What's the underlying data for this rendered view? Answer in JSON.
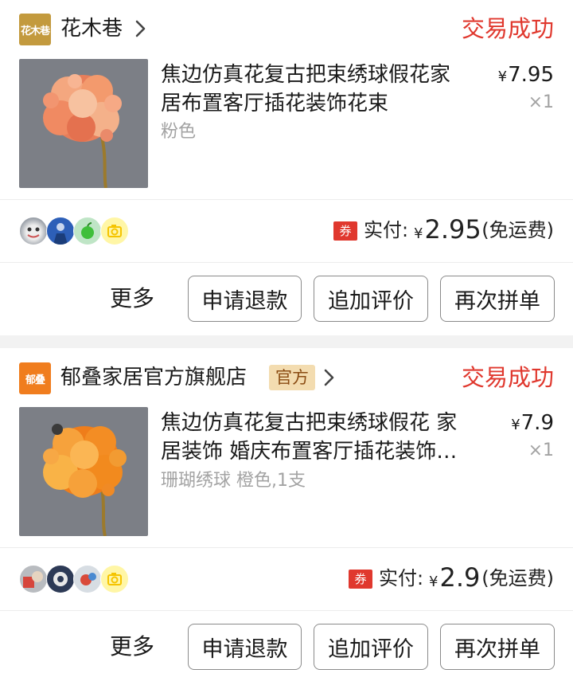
{
  "orders": [
    {
      "shop": {
        "logo_text": "花木巷",
        "logo_color": "#c39a3e",
        "name": "花木巷",
        "official_tag": ""
      },
      "status": "交易成功",
      "product": {
        "title_line1": "焦边仿真花复古把束绣球假花家",
        "title_line2": "居布置客厅插花装饰花束",
        "sku": "粉色",
        "price_symbol": "¥",
        "price": "7.95",
        "quantity": "×1",
        "image_colors": {
          "background": "#7c7f86",
          "bloom": "#f0946a",
          "stem": "#9c7a2c"
        }
      },
      "payment": {
        "coupon_badge": "券",
        "paid_label": "实付:",
        "paid_symbol": "¥",
        "paid_amount": "2.95",
        "shipping_note": "(免运费)"
      },
      "actions": {
        "more": "更多",
        "refund": "申请退款",
        "add_review": "追加评价",
        "rebuy": "再次拼单"
      }
    },
    {
      "shop": {
        "logo_text": "郁叠",
        "logo_color": "#f07d1e",
        "name": "郁叠家居官方旗舰店",
        "official_tag": "官方"
      },
      "status": "交易成功",
      "product": {
        "title_line1": "焦边仿真花复古把束绣球假花 家",
        "title_line2": "居装饰 婚庆布置客厅插花装饰…",
        "sku": "珊瑚绣球 橙色,1支",
        "price_symbol": "¥",
        "price": "7.9",
        "quantity": "×1",
        "image_colors": {
          "background": "#7c7f86",
          "bloom": "#f2861f",
          "stem": "#9c7a2c"
        }
      },
      "payment": {
        "coupon_badge": "券",
        "paid_label": "实付:",
        "paid_symbol": "¥",
        "paid_amount": "2.9",
        "shipping_note": "(免运费)"
      },
      "actions": {
        "more": "更多",
        "refund": "申请退款",
        "add_review": "追加评价",
        "rebuy": "再次拼单"
      }
    }
  ],
  "colors": {
    "status_red": "#e0382e",
    "official_tag_bg": "#f3dcb0",
    "page_bg": "#f2f2f2"
  }
}
